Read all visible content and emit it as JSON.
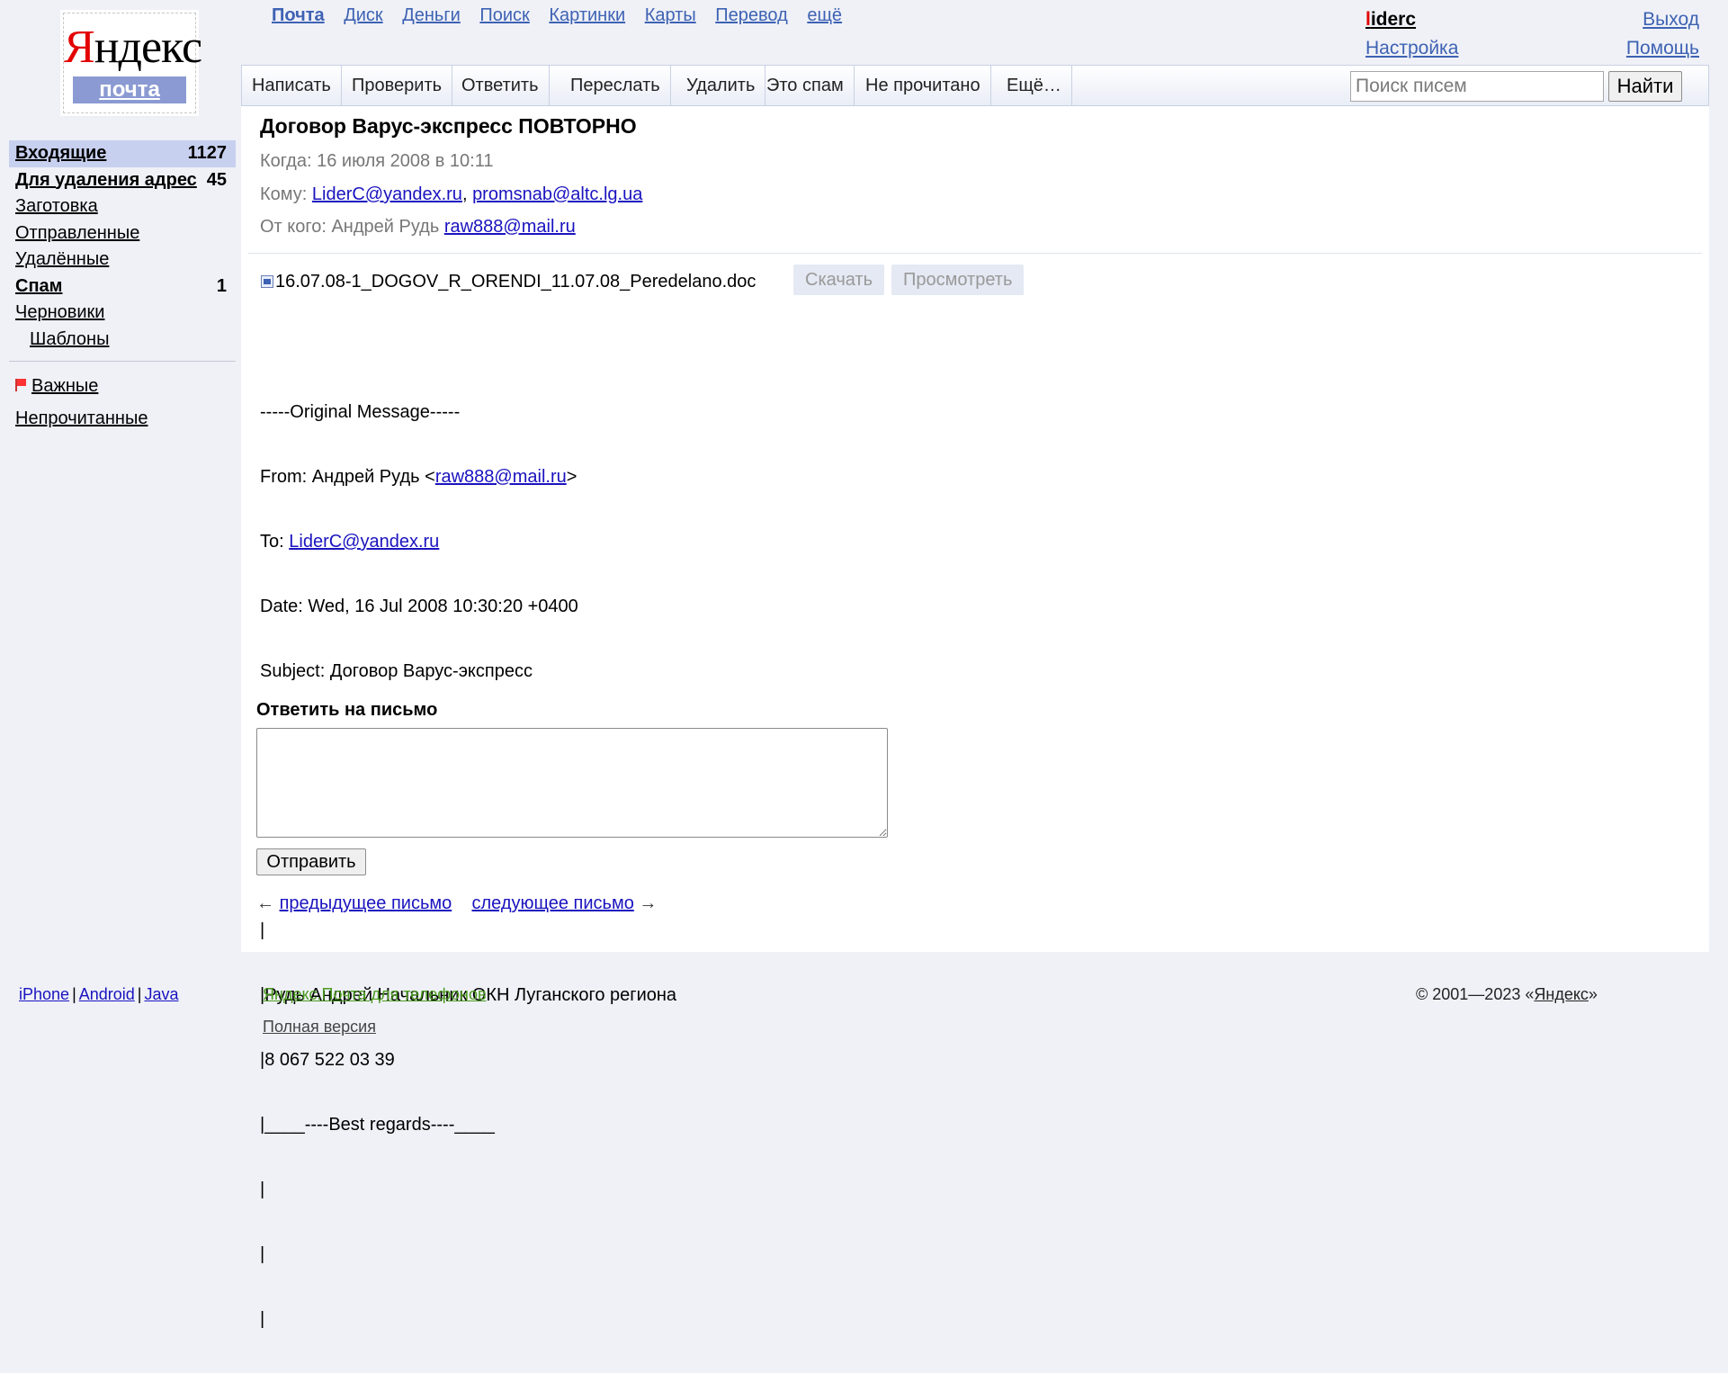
{
  "logo": {
    "first_letter": "Я",
    "rest": "ндекс",
    "sub": "почта"
  },
  "services": [
    {
      "label": "Почта",
      "current": true
    },
    {
      "label": "Диск"
    },
    {
      "label": "Деньги"
    },
    {
      "label": "Поиск"
    },
    {
      "label": "Картинки"
    },
    {
      "label": "Карты"
    },
    {
      "label": "Перевод"
    },
    {
      "label": "ещё"
    }
  ],
  "user": {
    "login_first": "l",
    "login_rest": "iderc",
    "settings": "Настройка",
    "logout": "Выход",
    "help": "Помощь"
  },
  "toolbar": {
    "buttons": [
      "Написать",
      "Проверить",
      "Ответить",
      "Переслать",
      "Удалить",
      "Это спам",
      "Не прочитано",
      "Ещё…"
    ],
    "search_placeholder": "Поиск писем",
    "search_button": "Найти"
  },
  "folders": [
    {
      "name": "Входящие",
      "count": "1127",
      "bold": true,
      "active": true
    },
    {
      "name": "Для удаления адрес",
      "count": "45",
      "bold": true
    },
    {
      "name": "Заготовка",
      "count": ""
    },
    {
      "name": "Отправленные",
      "count": ""
    },
    {
      "name": "Удалённые",
      "count": ""
    },
    {
      "name": "Спам",
      "count": "1",
      "bold": true
    },
    {
      "name": "Черновики",
      "count": ""
    },
    {
      "name": "Шаблоны",
      "count": "",
      "sub": true
    }
  ],
  "sidebar_extra": {
    "important": "Важные",
    "unread": "Непрочитанные"
  },
  "message": {
    "subject": "Договор Варус-экспресс ПОВТОРНО",
    "when_label": "Когда:",
    "when_value": "16 июля 2008 в 10:11",
    "to_label": "Кому:",
    "to": [
      "LiderC@yandex.ru",
      "promsnab@altc.lg.ua"
    ],
    "from_label": "От кого:",
    "from_name": "Андрей Рудь",
    "from_email": "raw888@mail.ru",
    "attachment": "16.07.08-1_DOGOV_R_ORENDI_11.07.08_Peredelano.doc",
    "download": "Скачать",
    "view": "Просмотреть",
    "body": {
      "original_header": "-----Original Message-----",
      "from_prefix": "From: Андрей Рудь <",
      "from_email": "raw888@mail.ru",
      "from_suffix": ">",
      "to_prefix": "To: ",
      "to_email": "LiderC@yandex.ru",
      "date_line": "Date: Wed, 16 Jul 2008 10:30:20 +0400",
      "subject_line": "Subject: Договор Варус-экспресс",
      "sig_line1": "|",
      "sig_line2": "|",
      "sig_line3": "|",
      "sig_name": "|Рудь Андрей Начальник ОКН Луганского региона",
      "sig_phone": "|8 067 522 03 39",
      "sig_regards": "|____----Best regards----____",
      "sig_line4": "|",
      "sig_line5": "|",
      "sig_line6": "|"
    }
  },
  "reply": {
    "title": "Ответить на письмо",
    "send": "Отправить"
  },
  "nav": {
    "prev_arrow": "←",
    "prev": "предыдущее письмо",
    "next": "следующее письмо",
    "next_arrow": "→"
  },
  "footer": {
    "apps": [
      "iPhone",
      "Android",
      "Java"
    ],
    "mobile": "Яндекс.Почта для телефонов",
    "full": "Полная версия",
    "copyright_prefix": "© 2001—2023 «",
    "copyright_link": "Яндекс",
    "copyright_suffix": "»"
  }
}
